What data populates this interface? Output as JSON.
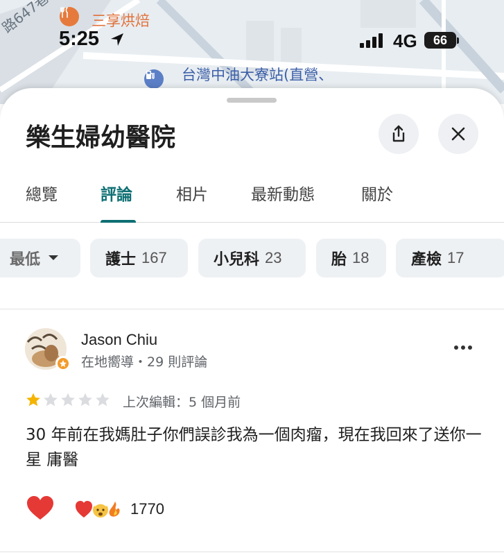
{
  "map": {
    "poi_bakery": "三享烘焙",
    "poi_gas_station": "台灣中油大寮站(直營、",
    "street_label": "路647巷"
  },
  "status_bar": {
    "time": "5:25",
    "network": "4G",
    "battery": "66"
  },
  "place": {
    "title": "樂生婦幼醫院"
  },
  "tabs": [
    {
      "label": "總覽"
    },
    {
      "label": "評論"
    },
    {
      "label": "相片"
    },
    {
      "label": "最新動態"
    },
    {
      "label": "關於"
    }
  ],
  "active_tab": "評論",
  "filters": {
    "sort_label": "最低",
    "chips": [
      {
        "label": "護士",
        "count": "167"
      },
      {
        "label": "小兒科",
        "count": "23"
      },
      {
        "label": "胎",
        "count": "18"
      },
      {
        "label": "產檢",
        "count": "17"
      }
    ]
  },
  "review": {
    "author": "Jason Chiu",
    "meta": "在地嚮導・29 則評論",
    "rating": 1,
    "max_rating": 5,
    "edited": "上次編輯：5 個月前",
    "text": "30 年前在我媽肚子你們誤診我為一個肉瘤，現在我回來了送你一星 庸醫",
    "reaction_count": "1770"
  },
  "colors": {
    "accent": "#0e6f73",
    "star_filled": "#f4b400",
    "star_empty": "#dadce0",
    "heart": "#e53935"
  }
}
